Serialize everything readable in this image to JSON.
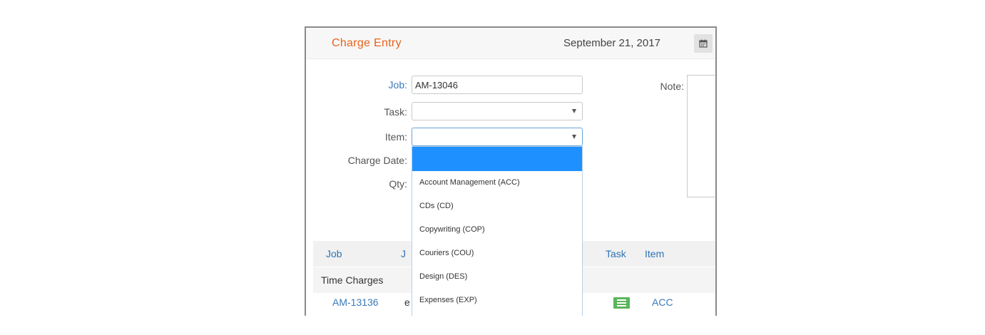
{
  "header": {
    "title": "Charge Entry",
    "date": "September 21, 2017"
  },
  "form": {
    "job_label": "Job:",
    "job_value": "AM-13046",
    "task_label": "Task:",
    "item_label": "Item:",
    "charge_date_label": "Charge Date:",
    "qty_label": "Qty:",
    "note_label": "Note:"
  },
  "item_dropdown": {
    "options": [
      "Account Management (ACC)",
      "CDs (CD)",
      "Copywriting (COP)",
      "Couriers (COU)",
      "Design (DES)",
      "Expenses (EXP)"
    ]
  },
  "table": {
    "headers": {
      "job": "Job",
      "col2": "J",
      "task": "Task",
      "item": "Item"
    },
    "group_label": "Time Charges",
    "rows": [
      {
        "job": "AM-13136",
        "col2": "e",
        "item": "ACC"
      }
    ]
  },
  "colors": {
    "title": "#e8631c",
    "link": "#3a7ab8",
    "dropdown_highlight": "#1e90ff",
    "task_icon": "#5bb55b"
  }
}
